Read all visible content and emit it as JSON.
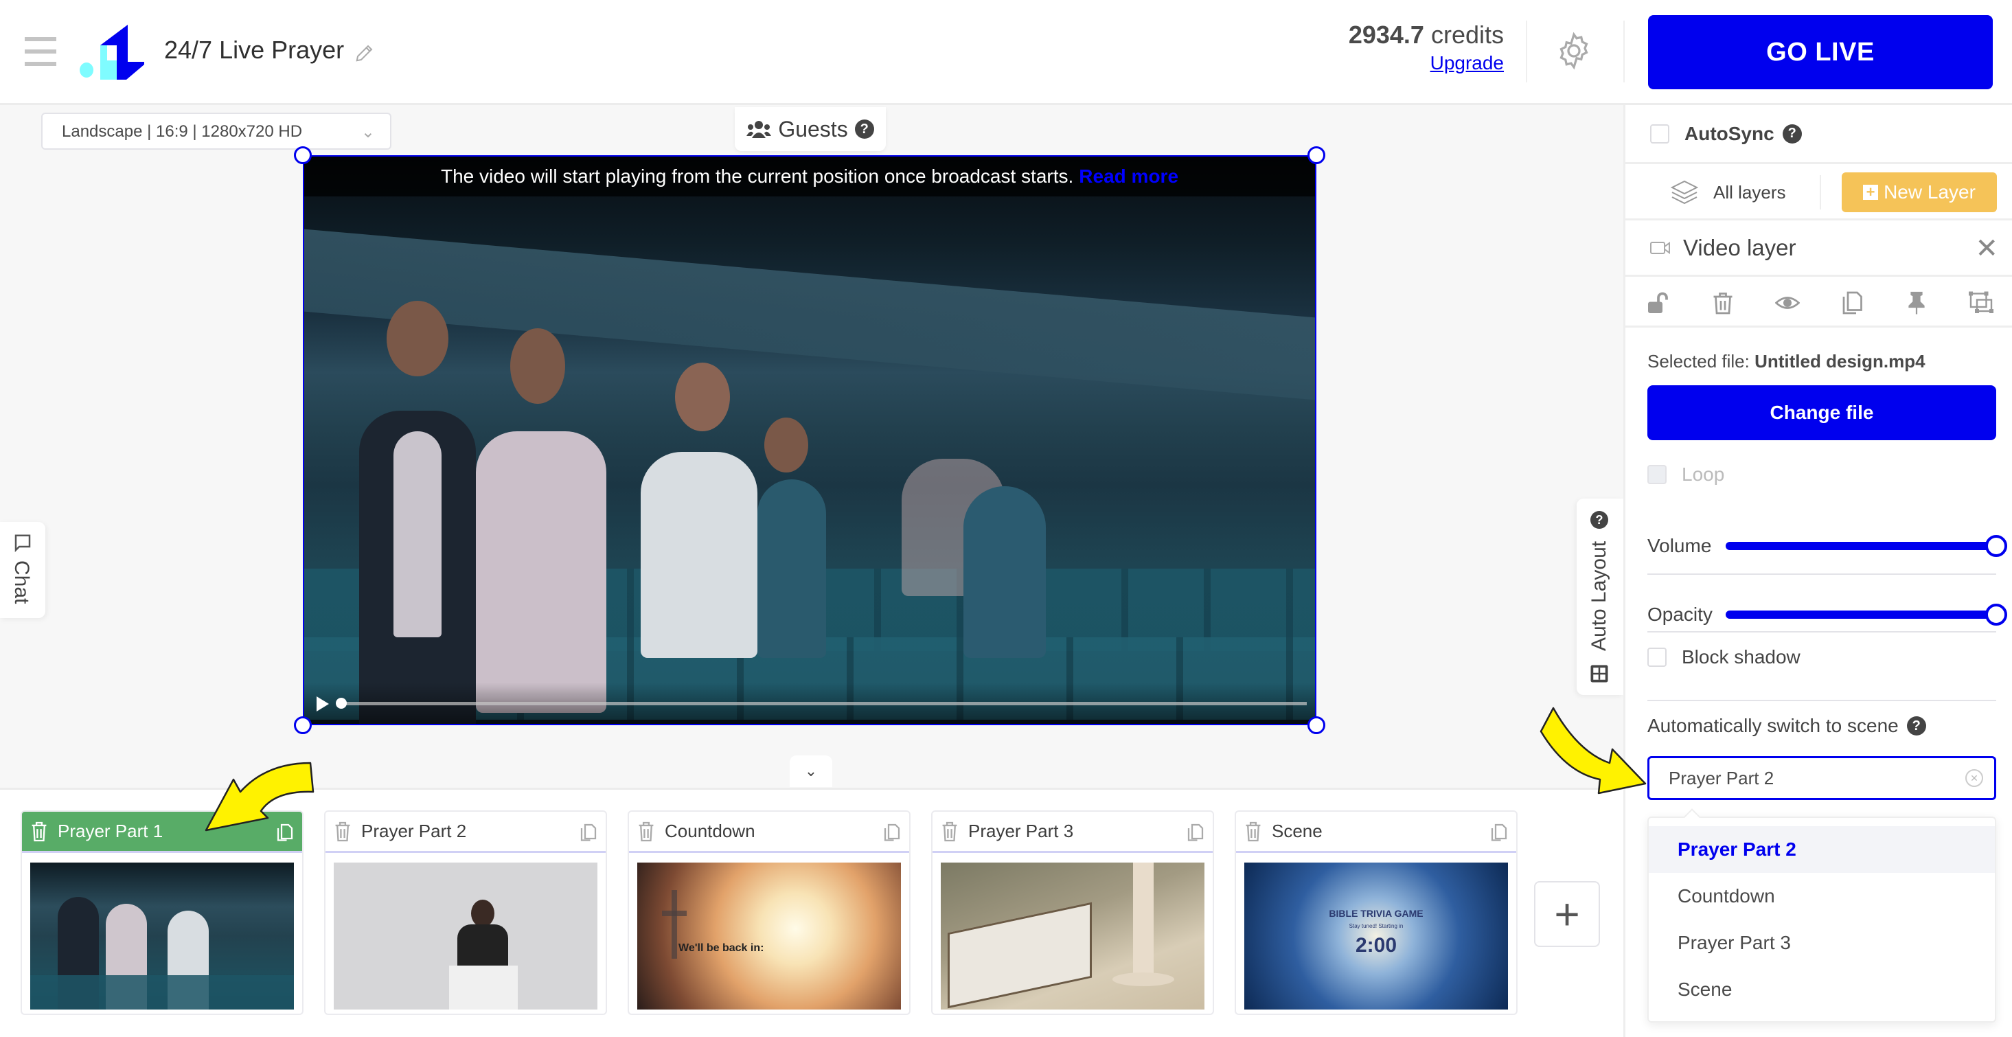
{
  "header": {
    "app_title": "24/7 Live Prayer",
    "credits_amount": "2934.7",
    "credits_unit": "credits",
    "upgrade_label": "Upgrade",
    "go_live_label": "GO LIVE"
  },
  "canvas": {
    "resolution_select": "Landscape | 16:9 | 1280x720 HD",
    "guests_label": "Guests",
    "notice_text": "The video will start playing from the current position once broadcast starts.",
    "read_more_label": "Read more",
    "chat_tab_label": "Chat",
    "auto_layout_label": "Auto Layout",
    "video_progress_percent": 0
  },
  "scenes": [
    {
      "name": "Prayer Part 1",
      "active": true,
      "thumbnail": "people praying in auditorium"
    },
    {
      "name": "Prayer Part 2",
      "active": false,
      "thumbnail": "priest at white podium"
    },
    {
      "name": "Countdown",
      "active": false,
      "thumbnail": "praying hands with cross",
      "overlay_text": "We'll be back in:"
    },
    {
      "name": "Prayer Part 3",
      "active": false,
      "thumbnail": "open bible and chalice"
    },
    {
      "name": "Scene",
      "active": false,
      "thumbnail": "bible trivia game",
      "overlay_title": "BIBLE TRIVIA GAME",
      "overlay_sub": "Stay tuned! Starting in",
      "overlay_time": "2:00"
    }
  ],
  "panel": {
    "autosync_label": "AutoSync",
    "autosync_checked": false,
    "all_layers_label": "All layers",
    "new_layer_label": "New Layer",
    "layer_title": "Video layer",
    "tools": [
      "unlock-icon",
      "trash-icon",
      "eye-icon",
      "copy-icon",
      "pin-icon",
      "resize-icon"
    ],
    "selected_file_label": "Selected file:",
    "selected_file_name": "Untitled design.mp4",
    "change_file_label": "Change file",
    "loop_label": "Loop",
    "loop_checked": false,
    "volume_label": "Volume",
    "volume_value": 100,
    "opacity_label": "Opacity",
    "opacity_value": 100,
    "block_shadow_label": "Block shadow",
    "block_shadow_checked": false,
    "auto_switch_label": "Automatically switch to scene",
    "auto_switch_value": "Prayer Part 2",
    "auto_switch_options": [
      "Prayer Part 2",
      "Countdown",
      "Prayer Part 3",
      "Scene"
    ],
    "auto_switch_selected_index": 0
  },
  "colors": {
    "brand_blue": "#0000ee",
    "active_scene_green": "#58ac67",
    "new_layer_yellow": "#f5c358",
    "logo_cyan": "#7ffcff"
  }
}
